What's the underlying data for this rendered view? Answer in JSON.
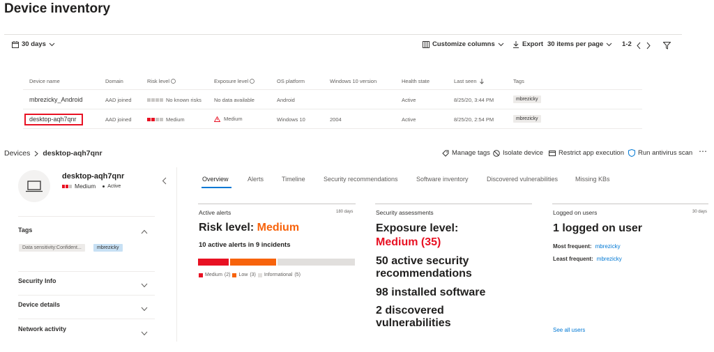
{
  "page_title": "Device inventory",
  "toolbar": {
    "period": "30 days",
    "customize": "Customize columns",
    "export": "Export",
    "per_page": "30 items per page",
    "range": "1-2"
  },
  "table": {
    "headers": [
      "Device name",
      "Domain",
      "Risk level",
      "Exposure level",
      "OS platform",
      "Windows 10 version",
      "Health state",
      "Last seen",
      "Tags"
    ],
    "rows": [
      {
        "name": "mbrezicky_Android",
        "domain": "AAD joined",
        "risk": "No known risks",
        "exposure": "No data available",
        "os": "Android",
        "version": "",
        "health": "Active",
        "last_seen": "8/25/20, 3:44 PM",
        "tag": "mbrezicky"
      },
      {
        "name": "desktop-aqh7qnr",
        "domain": "AAD joined",
        "risk": "Medium",
        "exposure": "Medium",
        "os": "Windows 10",
        "version": "2004",
        "health": "Active",
        "last_seen": "8/25/20, 2:54 PM",
        "tag": "mbrezicky"
      }
    ]
  },
  "breadcrumb": {
    "root": "Devices",
    "current": "desktop-aqh7qnr"
  },
  "actions": [
    "Manage tags",
    "Isolate device",
    "Restrict app execution",
    "Run antivirus scan"
  ],
  "device": {
    "name": "desktop-aqh7qnr",
    "risk": "Medium",
    "state": "Active"
  },
  "sidebar": {
    "tags_label": "Tags",
    "tags": [
      "Data sensitivity:Confident...",
      "mbrezicky"
    ],
    "sections": [
      "Security Info",
      "Device details",
      "Network activity"
    ]
  },
  "tabs": [
    "Overview",
    "Alerts",
    "Timeline",
    "Security recommendations",
    "Software inventory",
    "Discovered vulnerabilities",
    "Missing KBs"
  ],
  "active_alerts": {
    "title": "Active alerts",
    "period": "180 days",
    "risk_prefix": "Risk level: ",
    "risk_value": "Medium",
    "summary": "10 active alerts in 9 incidents",
    "legend": {
      "medium": "Medium",
      "medium_count": "(2)",
      "low": "Low",
      "low_count": "(3)",
      "info": "Informational",
      "info_count": "(5)"
    },
    "bar_fractions": {
      "medium": 0.2,
      "low": 0.3,
      "informational": 0.5
    }
  },
  "security_assessments": {
    "title": "Security assessments",
    "exposure_prefix": "Exposure level:",
    "exposure_value": "Medium (35)",
    "recommendations": "50 active security recommendations",
    "software": "98 installed software",
    "vulnerabilities": "2 discovered vulnerabilities"
  },
  "logged_on": {
    "title": "Logged on users",
    "period": "30 days",
    "headline": "1 logged on user",
    "most_label": "Most frequent:",
    "most_user": "mbrezicky",
    "least_label": "Least frequent:",
    "least_user": "mbrezicky",
    "see_all": "See all users"
  },
  "colors": {
    "medium": "#e81123",
    "orange": "#f7630c",
    "accent": "#0078d4",
    "tag_blue": "#c7e0f4",
    "gray_bar": "#e1dfdd"
  }
}
